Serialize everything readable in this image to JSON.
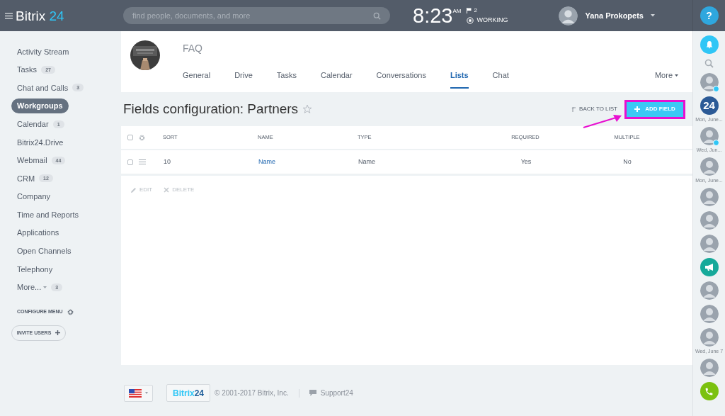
{
  "header": {
    "logo_main": "Bitrix",
    "logo_num": "24",
    "search": {
      "placeholder": "find people, documents, and more"
    },
    "time": "8:23",
    "ampm": "AM",
    "flags": "2",
    "status": "WORKING",
    "user": "Yana Prokopets",
    "help": "?"
  },
  "sidebar": {
    "items": [
      {
        "label": "Activity Stream",
        "selected": false
      },
      {
        "label": "Tasks",
        "count": "27",
        "selected": false
      },
      {
        "label": "Chat and Calls",
        "count": "3",
        "selected": false
      },
      {
        "label": "Workgroups",
        "selected": true
      },
      {
        "label": "Calendar",
        "count": "1",
        "selected": false
      },
      {
        "label": "Bitrix24.Drive",
        "selected": false
      },
      {
        "label": "Webmail",
        "count": "44",
        "selected": false
      },
      {
        "label": "CRM",
        "count": "12",
        "selected": false
      },
      {
        "label": "Company",
        "selected": false
      },
      {
        "label": "Time and Reports",
        "selected": false
      },
      {
        "label": "Applications",
        "selected": false
      },
      {
        "label": "Open Channels",
        "selected": false
      },
      {
        "label": "Telephony",
        "selected": false
      },
      {
        "label": "More...",
        "count": "3",
        "dropdown": true,
        "selected": false
      }
    ],
    "configure": "CONFIGURE MENU",
    "invite": "INVITE USERS"
  },
  "group": {
    "name": "FAQ",
    "tabs": [
      {
        "label": "General",
        "selected": false
      },
      {
        "label": "Drive",
        "selected": false
      },
      {
        "label": "Tasks",
        "selected": false
      },
      {
        "label": "Calendar",
        "selected": false
      },
      {
        "label": "Conversations",
        "selected": false
      },
      {
        "label": "Lists",
        "selected": true
      },
      {
        "label": "Chat",
        "selected": false
      }
    ],
    "more": "More"
  },
  "page": {
    "title": "Fields configuration: Partners",
    "back": "BACK TO LIST",
    "add": "ADD FIELD"
  },
  "table": {
    "columns": [
      "SORT",
      "NAME",
      "TYPE",
      "REQUIRED",
      "MULTIPLE"
    ],
    "select_all_checked": false,
    "rows": [
      {
        "checked": false,
        "cells": [
          "10",
          "Name",
          "Name",
          "Yes",
          "No"
        ]
      }
    ],
    "actions": [
      "EDIT",
      "DELETE"
    ]
  },
  "footer": {
    "logo_main": "Bitrix",
    "logo_num": "24",
    "copyright": "© 2001-2017 Bitrix, Inc.",
    "support": "Support24"
  },
  "rail": [
    {
      "kind": "bell"
    },
    {
      "kind": "search"
    },
    {
      "kind": "avatar",
      "online": true
    },
    {
      "kind": "badge",
      "text": "24",
      "caption": "Mon, June..."
    },
    {
      "kind": "avatar",
      "online": true,
      "caption": "Wed, Jun..."
    },
    {
      "kind": "avatar",
      "online": false,
      "caption": "Mon, June..."
    },
    {
      "kind": "avatar",
      "online": false
    },
    {
      "kind": "avatar",
      "online": false
    },
    {
      "kind": "avatar",
      "online": false
    },
    {
      "kind": "megaphone"
    },
    {
      "kind": "avatar",
      "online": false
    },
    {
      "kind": "avatar",
      "online": false
    },
    {
      "kind": "avatar",
      "online": false,
      "caption": "Wed, June 7"
    },
    {
      "kind": "avatar",
      "online": false
    },
    {
      "kind": "phone"
    }
  ]
}
